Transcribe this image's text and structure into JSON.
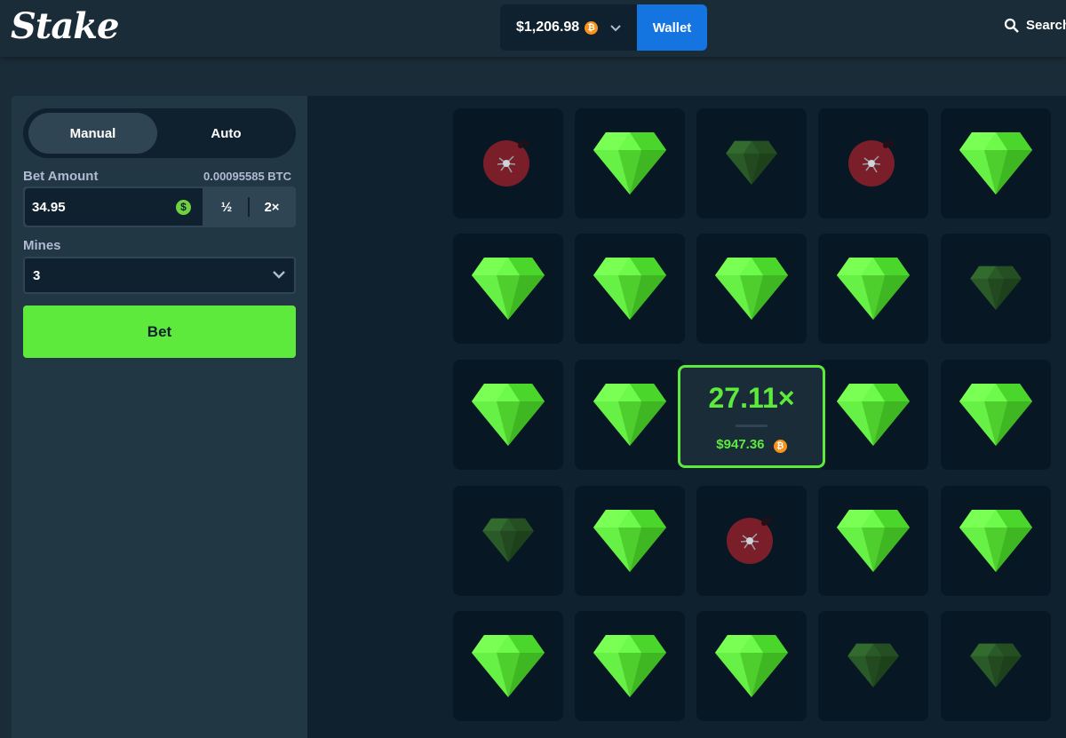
{
  "header": {
    "logo": "Stake",
    "balance": "$1,206.98",
    "currency_icon": "bitcoin-icon",
    "wallet_label": "Wallet",
    "search_label": "Search"
  },
  "sidebar": {
    "tabs": [
      {
        "label": "Manual",
        "active": true
      },
      {
        "label": "Auto",
        "active": false
      }
    ],
    "bet_amount_label": "Bet Amount",
    "bet_amount_btc": "0.00095585 BTC",
    "bet_amount_value": "34.95",
    "half_label": "½",
    "double_label": "2×",
    "mines_label": "Mines",
    "mines_value": "3",
    "bet_button": "Bet"
  },
  "board": {
    "cells": [
      "mine",
      "gem",
      "gem-dim",
      "mine",
      "gem",
      "gem",
      "gem",
      "gem",
      "gem",
      "gem-dim",
      "gem",
      "gem",
      "gem",
      "gem",
      "gem",
      "gem-dim",
      "gem",
      "mine",
      "gem",
      "gem",
      "gem",
      "gem",
      "gem",
      "gem-dim",
      "gem-dim"
    ],
    "popup": {
      "multiplier": "27.11×",
      "payout": "$947.36"
    }
  },
  "colors": {
    "accent_green": "#5eea3d",
    "wallet_blue": "#1475e1",
    "mine_red": "#7a1e2a"
  }
}
